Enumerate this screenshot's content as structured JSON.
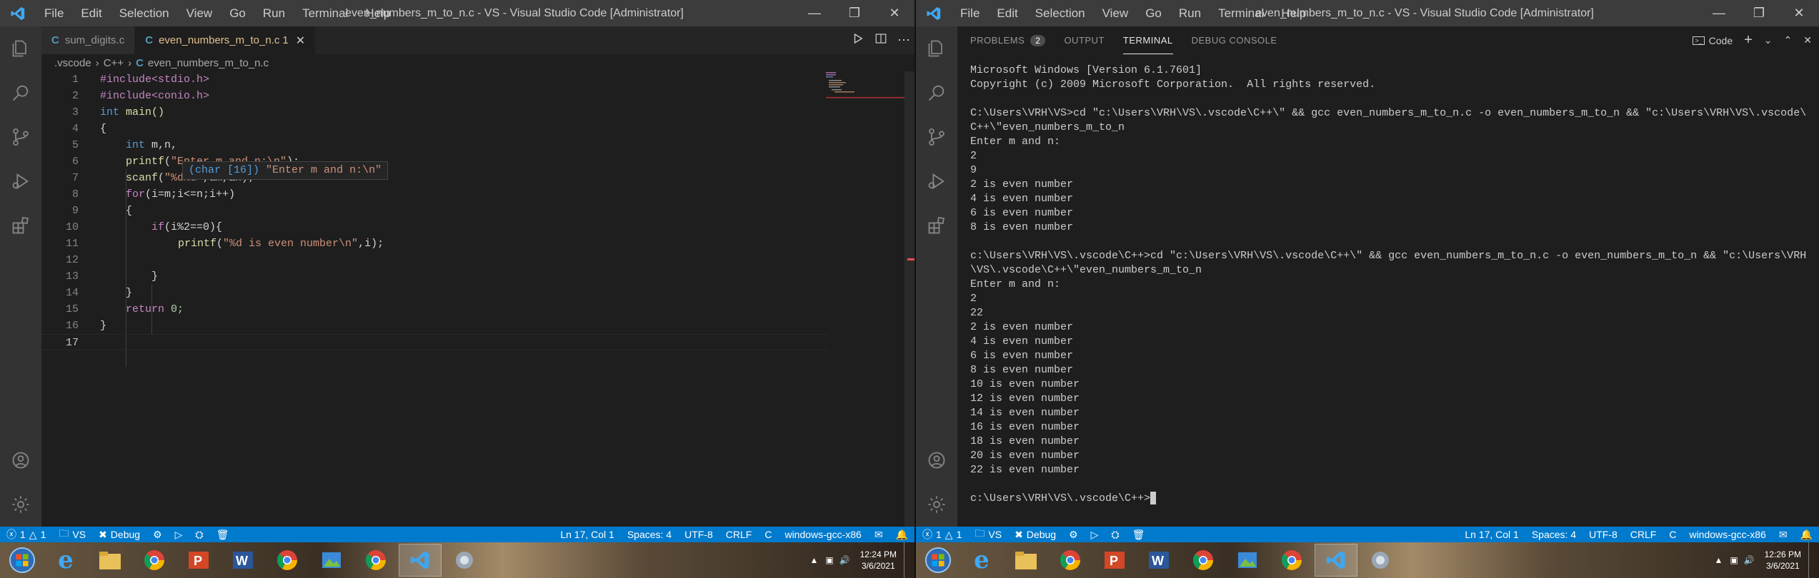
{
  "left": {
    "menu": [
      "File",
      "Edit",
      "Selection",
      "View",
      "Go",
      "Run",
      "Terminal",
      "Help"
    ],
    "title": "even_numbers_m_to_n.c - VS - Visual Studio Code [Administrator]",
    "tabs": [
      {
        "label": "sum_digits.c"
      },
      {
        "label": "even_numbers_m_to_n.c",
        "problems": "1"
      }
    ],
    "breadcrumb": [
      ".vscode",
      "C++",
      "even_numbers_m_to_n.c"
    ],
    "line_numbers": [
      "1",
      "2",
      "3",
      "4",
      "5",
      "6",
      "7",
      "8",
      "9",
      "10",
      "11",
      "12",
      "13",
      "14",
      "15",
      "16",
      "17"
    ],
    "code": {
      "l1": "#include<stdio.h>",
      "l2": "#include<conio.h>",
      "l3a": "int",
      "l3b": " main()",
      "l4": "{",
      "l5a": "int",
      "l5b": " m,n,",
      "l6a": "printf",
      "l6b": "(",
      "l6c": "\"Enter m and n:\\n\"",
      "l6d": ");",
      "l7a": "scanf",
      "l7b": "(",
      "l7c": "\"%d%d\"",
      "l7d": ",&m,&n);",
      "l8a": "for",
      "l8b": "(i=m;i<=n;i++)",
      "l9": "{",
      "l10a": "if",
      "l10b": "(i%2==0){",
      "l11a": "printf",
      "l11b": "(",
      "l11c": "\"%d is even number\\n\"",
      "l11d": ",i);",
      "l12": "",
      "l13": "}",
      "l14": "}",
      "l15a": "return",
      "l15b": " 0;",
      "l16": "}",
      "l17": ""
    },
    "tooltip": {
      "type": "(char [16])",
      "value": "\"Enter m and n:\\n\""
    },
    "status": {
      "errors": "1",
      "warnings": "1",
      "folder": "VS",
      "debug": "Debug",
      "position": "Ln 17, Col 1",
      "spaces": "Spaces: 4",
      "encoding": "UTF-8",
      "eol": "CRLF",
      "language": "C",
      "config": "windows-gcc-x86"
    },
    "clock": {
      "time": "12:24 PM",
      "date": "3/6/2021"
    }
  },
  "right": {
    "menu": [
      "File",
      "Edit",
      "Selection",
      "View",
      "Go",
      "Run",
      "Terminal",
      "Help"
    ],
    "title": "even_numbers_m_to_n.c - VS - Visual Studio Code [Administrator]",
    "panel_tabs": [
      {
        "label": "PROBLEMS",
        "badge": "2"
      },
      {
        "label": "OUTPUT"
      },
      {
        "label": "TERMINAL"
      },
      {
        "label": "DEBUG CONSOLE"
      }
    ],
    "terminal_shell": "Code",
    "terminal_lines": [
      "Microsoft Windows [Version 6.1.7601]",
      "Copyright (c) 2009 Microsoft Corporation.  All rights reserved.",
      "",
      "C:\\Users\\VRH\\VS>cd \"c:\\Users\\VRH\\VS\\.vscode\\C++\\\" && gcc even_numbers_m_to_n.c -o even_numbers_m_to_n && \"c:\\Users\\VRH\\VS\\.vscode\\",
      "C++\\\"even_numbers_m_to_n",
      "Enter m and n:",
      "2",
      "9",
      "2 is even number",
      "4 is even number",
      "6 is even number",
      "8 is even number",
      "",
      "c:\\Users\\VRH\\VS\\.vscode\\C++>cd \"c:\\Users\\VRH\\VS\\.vscode\\C++\\\" && gcc even_numbers_m_to_n.c -o even_numbers_m_to_n && \"c:\\Users\\VRH",
      "\\VS\\.vscode\\C++\\\"even_numbers_m_to_n",
      "Enter m and n:",
      "2",
      "22",
      "2 is even number",
      "4 is even number",
      "6 is even number",
      "8 is even number",
      "10 is even number",
      "12 is even number",
      "14 is even number",
      "16 is even number",
      "18 is even number",
      "20 is even number",
      "22 is even number",
      ""
    ],
    "prompt": "c:\\Users\\VRH\\VS\\.vscode\\C++>",
    "status": {
      "errors": "1",
      "warnings": "1",
      "folder": "VS",
      "debug": "Debug",
      "position": "Ln 17, Col 1",
      "spaces": "Spaces: 4",
      "encoding": "UTF-8",
      "eol": "CRLF",
      "language": "C",
      "config": "windows-gcc-x86"
    },
    "clock": {
      "time": "12:26 PM",
      "date": "3/6/2021"
    }
  },
  "colors": {
    "accent": "#007acc",
    "titlebar": "#3c3c3c",
    "editor_bg": "#1e1e1e",
    "activity_bar": "#333333"
  }
}
